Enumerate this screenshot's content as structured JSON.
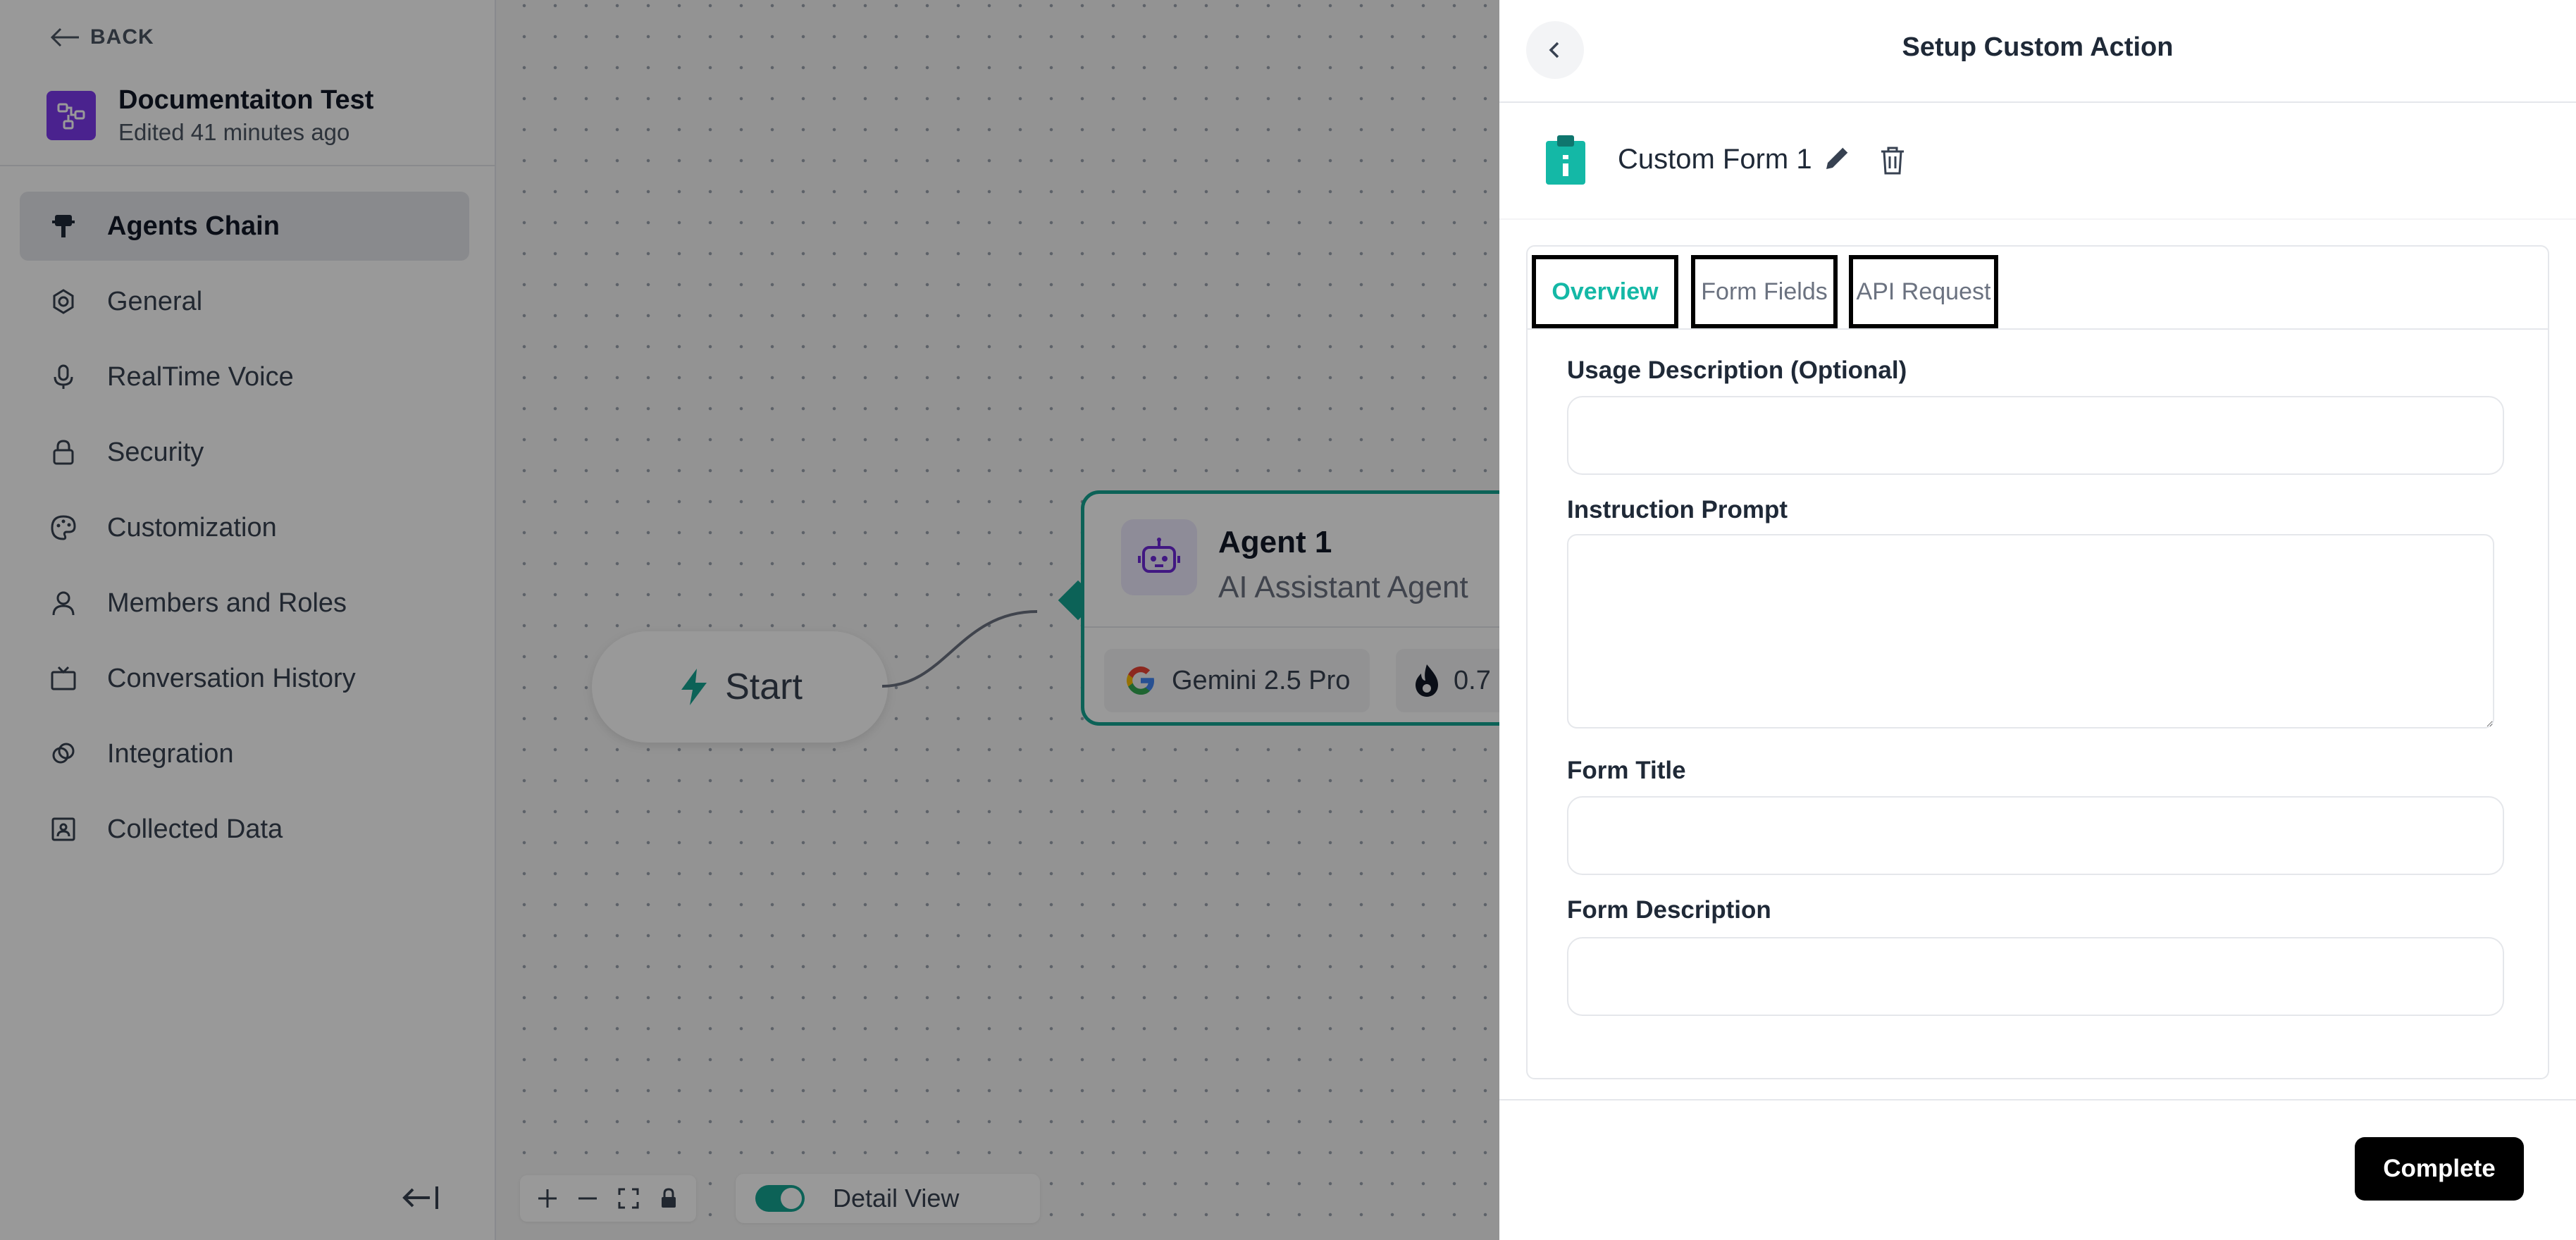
{
  "sidebar": {
    "back_label": "BACK",
    "project": {
      "name": "Documentaiton Test",
      "edited": "Edited 41 minutes ago"
    },
    "items": [
      {
        "label": "Agents Chain",
        "icon": "agents-chain-icon",
        "active": true
      },
      {
        "label": "General",
        "icon": "gear-icon",
        "active": false
      },
      {
        "label": "RealTime Voice",
        "icon": "microphone-icon",
        "active": false
      },
      {
        "label": "Security",
        "icon": "lock-icon",
        "active": false
      },
      {
        "label": "Customization",
        "icon": "palette-icon",
        "active": false
      },
      {
        "label": "Members and Roles",
        "icon": "user-icon",
        "active": false
      },
      {
        "label": "Conversation History",
        "icon": "tv-icon",
        "active": false
      },
      {
        "label": "Integration",
        "icon": "integration-icon",
        "active": false
      },
      {
        "label": "Collected Data",
        "icon": "id-card-icon",
        "active": false
      }
    ]
  },
  "canvas": {
    "start_label": "Start",
    "agent": {
      "title": "Agent 1",
      "subtitle": "AI Assistant Agent",
      "model": "Gemini 2.5 Pro",
      "temperature": "0.7"
    },
    "detail_view_label": "Detail View",
    "detail_view_on": true
  },
  "panel": {
    "title": "Setup Custom Action",
    "form_name": "Custom Form 1",
    "tabs": {
      "overview": "Overview",
      "form_fields": "Form Fields",
      "api_request": "API Request"
    },
    "active_tab": "Overview",
    "fields": {
      "usage_label": "Usage Description (Optional)",
      "usage_value": "",
      "instruction_label": "Instruction Prompt",
      "instruction_value": "",
      "form_title_label": "Form Title",
      "form_title_value": "",
      "form_desc_label": "Form Description",
      "form_desc_value": ""
    },
    "complete_label": "Complete"
  },
  "colors": {
    "accent": "#14a391",
    "tab_active": "#14b8a6",
    "brand_purple": "#7c3aed",
    "primary_button": "#000000"
  }
}
